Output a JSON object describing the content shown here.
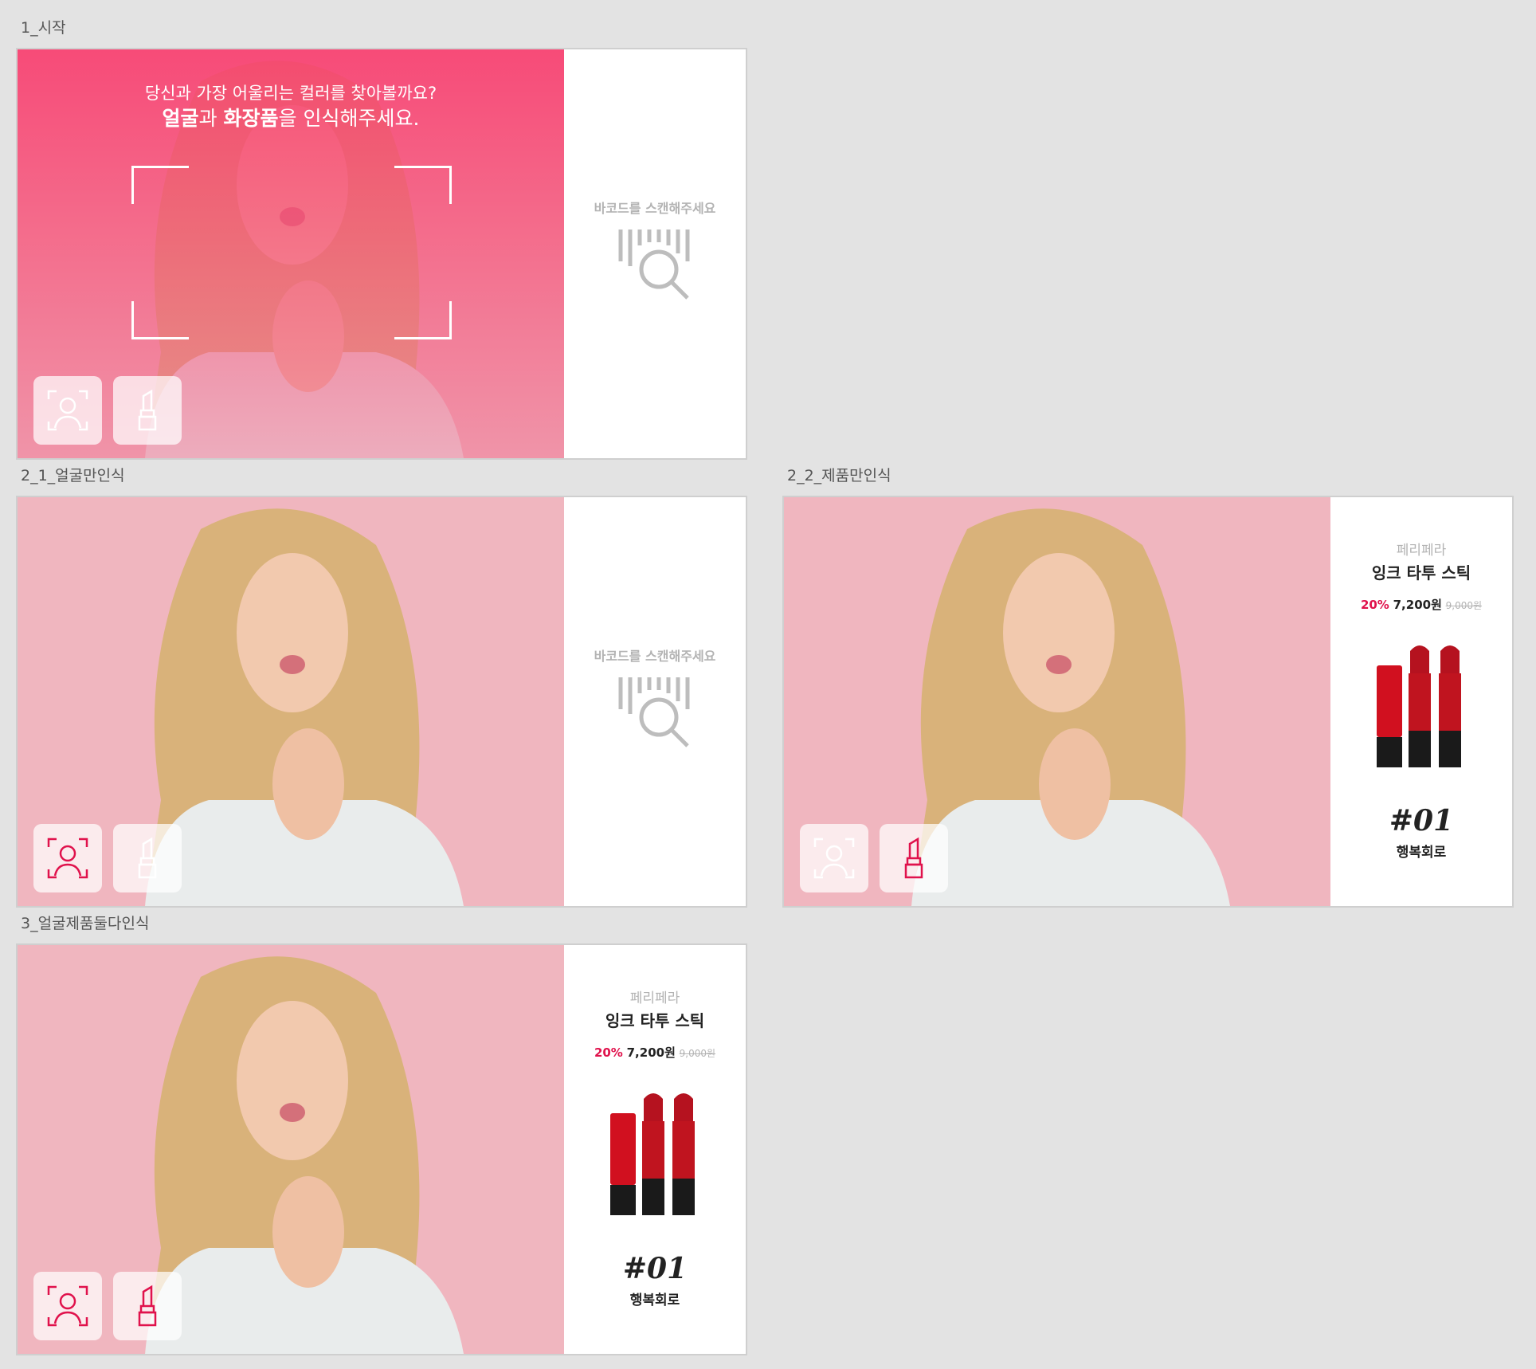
{
  "artboards": [
    {
      "label": "1_시작"
    },
    {
      "label": "2_1_얼굴만인식"
    },
    {
      "label": "2_2_제품만인식"
    },
    {
      "label": "3_얼굴제품둘다인식"
    }
  ],
  "prompt": {
    "line1": "당신과 가장 어울리는 컬러를 찾아볼까요?",
    "face_word": "얼굴",
    "connector": "과 ",
    "product_word": "화장품",
    "tail": "을 인식해주세요."
  },
  "scan": {
    "text": "바코드를 스캔해주세요",
    "icon": "barcode-scan-icon"
  },
  "product": {
    "brand": "페리페라",
    "name": "잉크 타투 스틱",
    "discount": "20%",
    "price": "7,200원",
    "original_price": "9,000원",
    "shade_number": "#01",
    "shade_name": "행복회로"
  },
  "icons": {
    "face": "face-scan-icon",
    "lipstick": "lipstick-icon"
  },
  "colors": {
    "accent": "#e0124c",
    "inactive_icon": "#ffffff",
    "scan_gray": "#b3b3b3",
    "photo_bg": "#f0b6bf"
  }
}
